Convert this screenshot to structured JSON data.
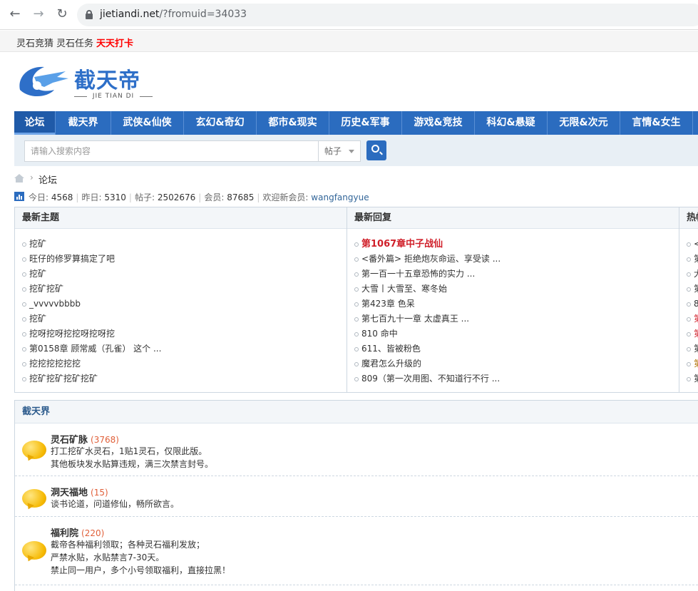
{
  "browser": {
    "url_host": "jietiandi.net",
    "url_path": "/?fromuid=34033"
  },
  "toplinks": [
    "灵石竞猜",
    "灵石任务",
    "天天打卡"
  ],
  "logo": {
    "cn": "截天帝",
    "en": "JIE TIAN DI"
  },
  "nav": [
    "论坛",
    "截天界",
    "武侠&仙侠",
    "玄幻&奇幻",
    "都市&现实",
    "历史&军事",
    "游戏&竞技",
    "科幻&悬疑",
    "无限&次元",
    "言情&女生"
  ],
  "search": {
    "placeholder": "请输入搜索内容",
    "type": "帖子"
  },
  "breadcrumb": {
    "sep": "›",
    "current": "论坛"
  },
  "stats": {
    "today_label": "今日:",
    "today": "4568",
    "yesterday_label": "昨日:",
    "yesterday": "5310",
    "posts_label": "帖子:",
    "posts": "2502676",
    "members_label": "会员:",
    "members": "87685",
    "welcome_label": "欢迎新会员:",
    "new_member": "wangfangyue"
  },
  "latest": {
    "new_topics_title": "最新主题",
    "new_topics": [
      "挖矿",
      "旺仔的修罗算搞定了吧",
      "挖矿",
      "挖矿挖矿",
      "_vvvvvbbbb",
      "挖矿",
      "挖呀挖呀挖挖呀挖呀挖",
      "第0158章 顾常威（孔雀） 这个 ...",
      "挖挖挖挖挖挖",
      "挖矿挖矿挖矿挖矿"
    ],
    "new_replies_title": "最新回复",
    "new_replies": [
      "第1067章中子战仙",
      "<番外篇> 拒绝炮灰命运、享受读 ...",
      "第一百一十五章恐怖的实力 ...",
      "大雪丨大雪至、寒冬始",
      "第423章 色呆",
      "第七百九十一章 太虚真王 ...",
      "810 命中",
      "611、皆被粉色",
      "魔君怎么升级的",
      "809（第一次用图、不知道行不行 ..."
    ],
    "hot_title": "热帖",
    "hot": [
      "<",
      "第",
      "大",
      "第",
      "8",
      "第",
      "第",
      "第",
      "第",
      "第"
    ]
  },
  "forum": {
    "section_title": "截天界",
    "boards": [
      {
        "name": "灵石矿脉",
        "count": "(3768)",
        "desc": [
          "打工挖矿水灵石，1贴1灵石，仅限此版。",
          "其他板块发水贴算违规，满三次禁言封号。"
        ]
      },
      {
        "name": "洞天福地",
        "count": "(15)",
        "desc": [
          "谈书论道，问道修仙，畅所欲言。"
        ]
      },
      {
        "name": "福利院",
        "count": "(220)",
        "desc": [
          "截帝各种福利领取；各种灵石福利发放；",
          "严禁水贴，水贴禁言7-30天。",
          "禁止同一用户，多个小号领取福利，直接拉黑！"
        ]
      }
    ]
  },
  "colors": {
    "nav_blue": "#2b6cbf",
    "hot_red": "#d0202a",
    "count_orange": "#e0603a"
  }
}
